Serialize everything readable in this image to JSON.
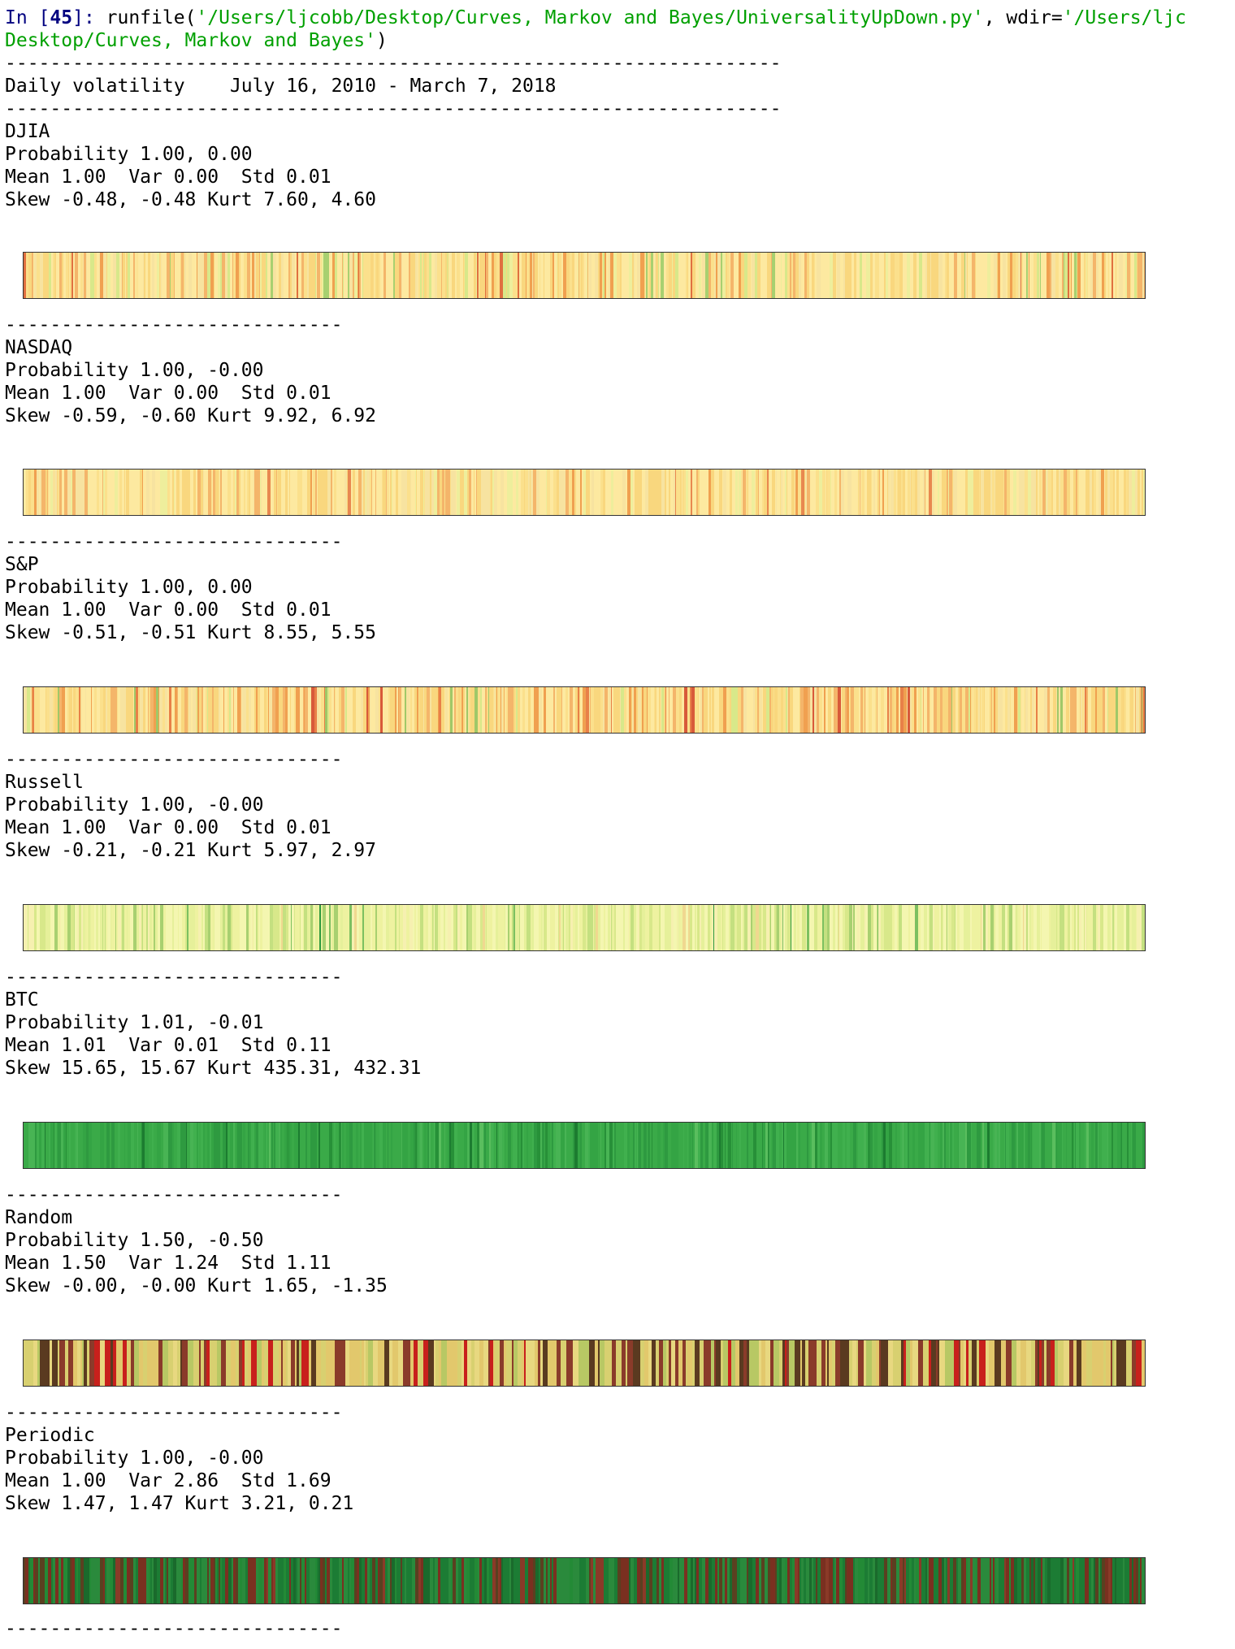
{
  "console": {
    "prompt_label": "In [",
    "prompt_number": "45",
    "prompt_close": "]: ",
    "command_name": "runfile(",
    "path_arg": "'/Users/ljcobb/Desktop/Curves, Markov and Bayes/UniversalityUpDown.py'",
    "comma": ", wdir=",
    "wdir_arg_part1": "'/Users/ljc",
    "wdir_arg_part2": "Desktop/Curves, Markov and Bayes'",
    "close_paren": ")"
  },
  "header": {
    "rule_long": "---------------------------------------------------------------------",
    "title": "Daily volatility    July 16, 2010 - March 7, 2018",
    "rule_short": "------------------------------"
  },
  "sections": [
    {
      "name": "DJIA",
      "probability": "Probability 1.00, 0.00",
      "moments": "Mean 1.00  Var 0.00  Std 0.01",
      "shape": "Skew -0.48, -0.48 Kurt 7.60, 4.60",
      "palette": [
        "#fde9a0",
        "#f9d77e",
        "#f7e3a0",
        "#fbe08c",
        "#f4b56a",
        "#eeee9c",
        "#f0a050",
        "#d8e88a",
        "#a8d070",
        "#e07040"
      ],
      "weights": [
        30,
        18,
        12,
        14,
        8,
        6,
        4,
        4,
        2,
        2
      ]
    },
    {
      "name": "NASDAQ",
      "probability": "Probability 1.00, -0.00",
      "moments": "Mean 1.00  Var 0.00  Std 0.01",
      "shape": "Skew -0.59, -0.60 Kurt 9.92, 6.92",
      "palette": [
        "#fde9a0",
        "#f9d77e",
        "#f7e3a0",
        "#fbe08c",
        "#f4b56a",
        "#eeee9c",
        "#f0a050",
        "#e88850"
      ],
      "weights": [
        34,
        20,
        14,
        14,
        8,
        6,
        3,
        1
      ]
    },
    {
      "name": "S&P",
      "probability": "Probability 1.00, 0.00",
      "moments": "Mean 1.00  Var 0.00  Std 0.01",
      "shape": "Skew -0.51, -0.51 Kurt 8.55, 5.55",
      "palette": [
        "#fde9a0",
        "#f9d77e",
        "#f7e3a0",
        "#fbe08c",
        "#f4b56a",
        "#f0a050",
        "#e88048",
        "#d8e88a",
        "#a0c868",
        "#d85a3a"
      ],
      "weights": [
        28,
        18,
        12,
        14,
        10,
        6,
        4,
        4,
        2,
        2
      ]
    },
    {
      "name": "Russell",
      "probability": "Probability 1.00, -0.00",
      "moments": "Mean 1.00  Var 0.00  Std 0.01",
      "shape": "Skew -0.21, -0.21 Kurt 5.97, 2.97",
      "palette": [
        "#f4f6b0",
        "#eef2a0",
        "#e6f09a",
        "#d8e88a",
        "#c4e080",
        "#f6f0b0",
        "#a8d070",
        "#7cc060",
        "#f0d890",
        "#2e9a40"
      ],
      "weights": [
        26,
        18,
        14,
        12,
        10,
        8,
        6,
        3,
        2,
        1
      ]
    },
    {
      "name": "BTC",
      "probability": "Probability 1.01, -0.01",
      "moments": "Mean 1.01  Var 0.01  Std 0.11",
      "shape": "Skew 15.65, 15.67 Kurt 435.31, 432.31",
      "palette": [
        "#3aaa48",
        "#34a444",
        "#40b04e",
        "#2e9a40",
        "#48b454",
        "#279038",
        "#5abe5e",
        "#1c7c30"
      ],
      "weights": [
        30,
        22,
        16,
        12,
        8,
        6,
        4,
        2
      ]
    },
    {
      "name": "Random",
      "probability": "Probability 1.50, -0.50",
      "moments": "Mean 1.50  Var 1.24  Std 1.11",
      "shape": "Skew -0.00, -0.00 Kurt 1.65, -1.35",
      "palette": [
        "#e2c86c",
        "#d8d070",
        "#8a3b2a",
        "#5a3a20",
        "#c8201c",
        "#b8c864",
        "#e8d880"
      ],
      "weights": [
        24,
        16,
        20,
        12,
        10,
        10,
        8
      ]
    },
    {
      "name": "Periodic",
      "probability": "Probability 1.00, -0.00",
      "moments": "Mean 1.00  Var 2.86  Std 1.69",
      "shape": "Skew 1.47, 1.47 Kurt 3.21, 0.21",
      "palette": [
        "#1c7c34",
        "#2a8a3c",
        "#7a3020",
        "#5a4020",
        "#1a6a2c",
        "#238a36",
        "#8a3a28"
      ],
      "weights": [
        26,
        20,
        18,
        10,
        10,
        10,
        6
      ]
    }
  ]
}
